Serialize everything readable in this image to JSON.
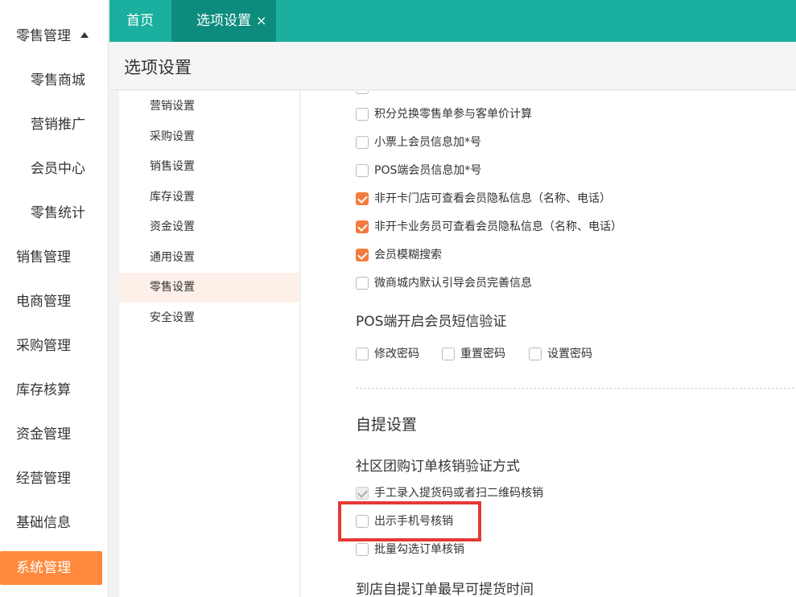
{
  "sidebar": {
    "items": [
      {
        "label": "零售管理",
        "expanded": true
      },
      {
        "label": "零售商城",
        "sub": true
      },
      {
        "label": "营销推广",
        "sub": true
      },
      {
        "label": "会员中心",
        "sub": true
      },
      {
        "label": "零售统计",
        "sub": true
      },
      {
        "label": "销售管理"
      },
      {
        "label": "电商管理"
      },
      {
        "label": "采购管理"
      },
      {
        "label": "库存核算"
      },
      {
        "label": "资金管理"
      },
      {
        "label": "经营管理"
      },
      {
        "label": "基础信息"
      },
      {
        "label": "系统管理",
        "active": true
      }
    ]
  },
  "tabs": [
    {
      "label": "首页"
    },
    {
      "label": "选项设置",
      "active": true,
      "close": "×"
    }
  ],
  "page_title": "选项设置",
  "subnav": {
    "items": [
      "营销设置",
      "采购设置",
      "销售设置",
      "库存设置",
      "资金设置",
      "通用设置",
      "零售设置",
      "安全设置"
    ],
    "active_index": 6
  },
  "options": [
    {
      "label": "积分兑换零售单参与客单价计算",
      "checked": false
    },
    {
      "label": "小票上会员信息加*号",
      "checked": false
    },
    {
      "label": "POS端会员信息加*号",
      "checked": false
    },
    {
      "label": "非开卡门店可查看会员隐私信息（名称、电话）",
      "checked": true
    },
    {
      "label": "非开卡业务员可查看会员隐私信息（名称、电话）",
      "checked": true
    },
    {
      "label": "会员模糊搜索",
      "checked": true
    },
    {
      "label": "微商城内默认引导会员完善信息",
      "checked": false
    }
  ],
  "pos_sms": {
    "label": "POS端开启会员短信验证",
    "options": [
      {
        "label": "修改密码",
        "checked": false
      },
      {
        "label": "重置密码",
        "checked": false
      },
      {
        "label": "设置密码",
        "checked": false
      }
    ]
  },
  "self_pickup": {
    "title": "自提设置",
    "verify_label": "社区团购订单核销验证方式",
    "verify_options": [
      {
        "label": "手工录入提货码或者扫二维码核销",
        "checked": true,
        "disabled": true
      },
      {
        "label": "出示手机号核销",
        "checked": false,
        "highlighted": true
      },
      {
        "label": "批量勾选订单核销",
        "checked": false
      }
    ],
    "earliest_label": "到店自提订单最早可提货时间"
  },
  "colors": {
    "brand": "#1aaf9e",
    "tab_active": "#0d8c7d",
    "accent": "#f47b3f",
    "sidebar_active": "#ff8a3d",
    "highlight": "#e53935"
  }
}
